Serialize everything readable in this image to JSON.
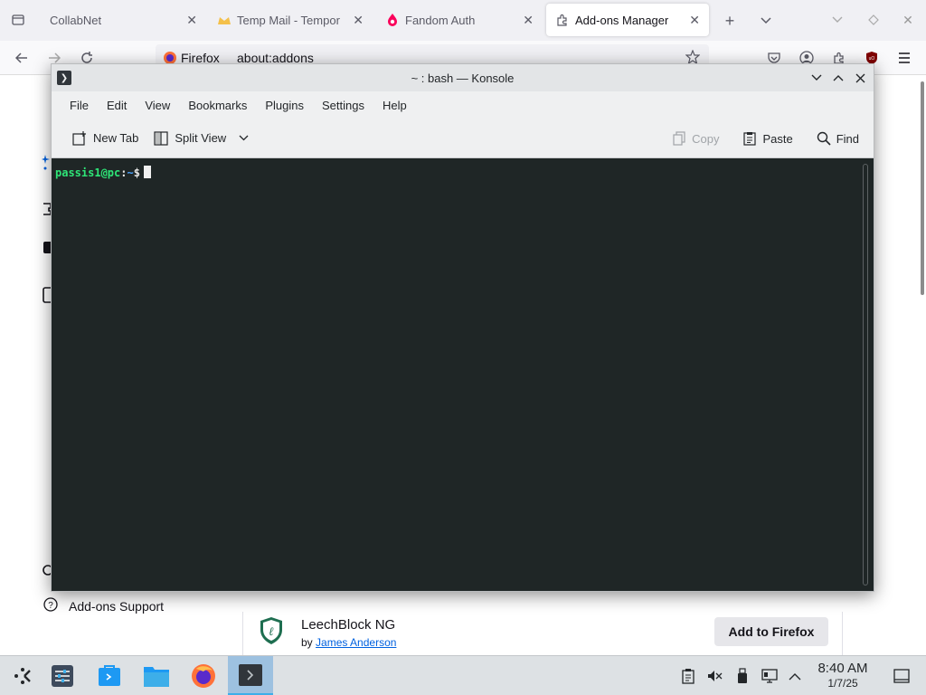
{
  "browser": {
    "tabs": [
      {
        "title": "CollabNet"
      },
      {
        "title": "Temp Mail - Tempor"
      },
      {
        "title": "Fandom Auth"
      },
      {
        "title": "Add-ons Manager"
      }
    ],
    "identity_label": "Firefox",
    "url": "about:addons"
  },
  "konsole": {
    "title": "~ : bash — Konsole",
    "menu": [
      "File",
      "Edit",
      "View",
      "Bookmarks",
      "Plugins",
      "Settings",
      "Help"
    ],
    "toolbar": {
      "new_tab": "New Tab",
      "split_view": "Split View",
      "copy": "Copy",
      "paste": "Paste",
      "find": "Find"
    },
    "prompt": {
      "user_host": "passis1@pc",
      "path": "~",
      "symbol": "$"
    }
  },
  "page": {
    "addons_support": "Add-ons Support",
    "addon": {
      "name": "LeechBlock NG",
      "by_label": "by",
      "author": "James Anderson",
      "button": "Add to Firefox"
    }
  },
  "taskbar": {
    "clock_time": "8:40 AM",
    "clock_date": "1/7/25"
  },
  "colors": {
    "accent": "#3daee9",
    "terminal_bg": "#1f2626",
    "prompt_green": "#2ee577",
    "link_blue": "#0061e0"
  }
}
